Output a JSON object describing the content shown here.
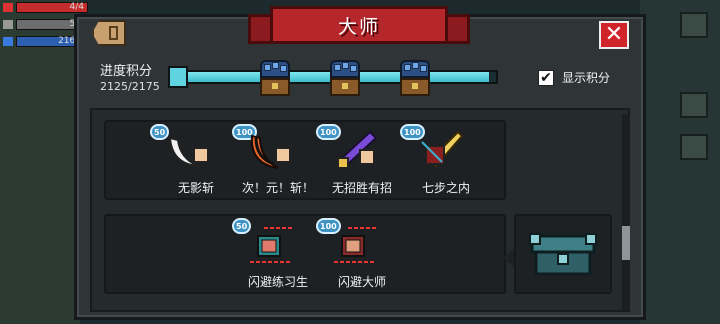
{
  "title": "大师",
  "hud": {
    "hp": "4/4",
    "armor": "5/5",
    "energy": "216/2"
  },
  "progress": {
    "label": "进度积分",
    "value": "2125/2175",
    "fraction": 0.977
  },
  "show_score": {
    "label": "显示积分",
    "checked": true,
    "check_glyph": "✔"
  },
  "close_glyph": "✕",
  "groups": [
    {
      "skills": [
        {
          "points": "50",
          "name": "无影斩",
          "icon": "white-crescent-slash-icon"
        },
        {
          "points": "100",
          "name": "次！元！斩！",
          "icon": "fire-crescent-slash-icon"
        },
        {
          "points": "100",
          "name": "无招胜有招",
          "icon": "purple-sword-icon"
        },
        {
          "points": "100",
          "name": "七步之内",
          "icon": "golden-blade-icon"
        }
      ]
    },
    {
      "skills": [
        {
          "points": "50",
          "name": "闪避练习生",
          "icon": "dodge-apprentice-icon"
        },
        {
          "points": "100",
          "name": "闪避大师",
          "icon": "dodge-master-icon"
        }
      ]
    }
  ],
  "colors": {
    "banner": "#b5272b",
    "progress": "#5fd4e0",
    "close": "#d1232a",
    "badge": "#3f93c4"
  }
}
